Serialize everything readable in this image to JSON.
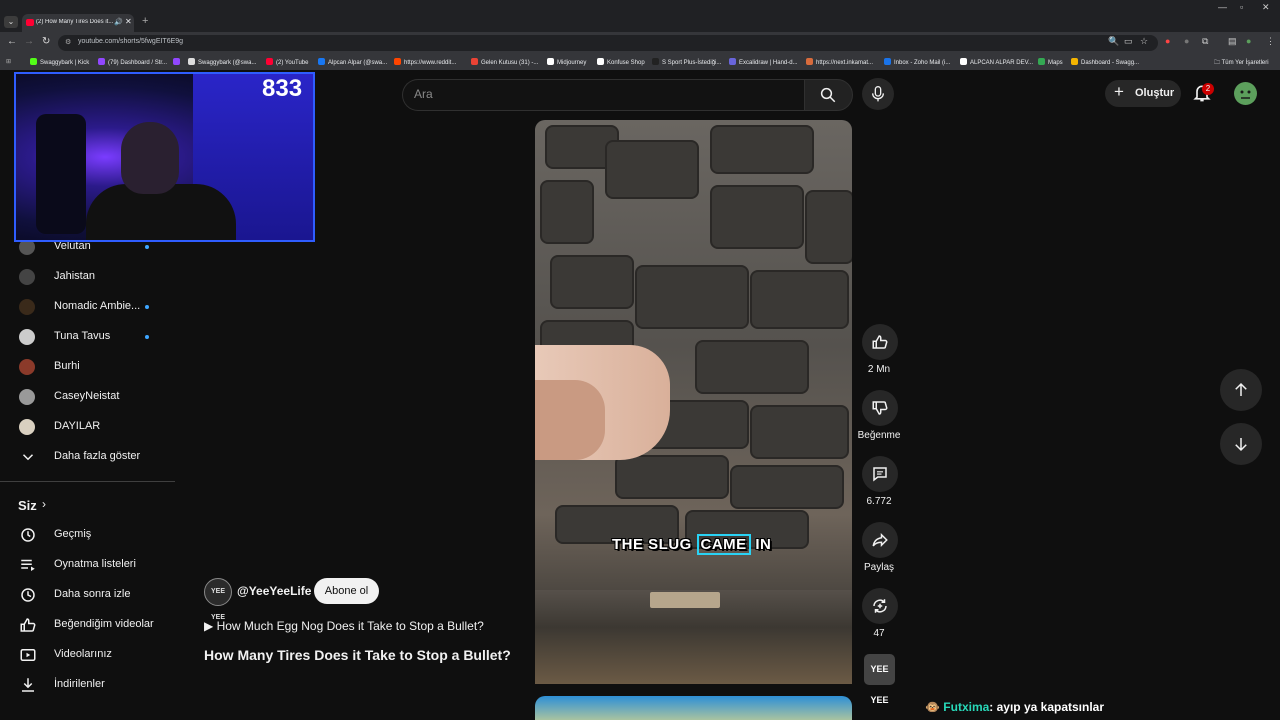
{
  "browser": {
    "tab_title": "(2) How Many Tires Does it...",
    "url": "youtube.com/shorts/5fwgEIT6E9g",
    "bookmarks": [
      {
        "label": "Swaggybark | Kick",
        "color": "#53fc18"
      },
      {
        "label": "(79) Dashboard / Str...",
        "color": "#9147ff"
      },
      {
        "label": "",
        "color": "#9147ff"
      },
      {
        "label": "Swaggybark (@swa...",
        "color": "#dddddd"
      },
      {
        "label": "(2) YouTube",
        "color": "#ff0033"
      },
      {
        "label": "Alpcan Alpar (@swa...",
        "color": "#1877f2"
      },
      {
        "label": "https://www.reddit...",
        "color": "#ff4500"
      },
      {
        "label": "Gelen Kutusu (31) -...",
        "color": "#ea4335"
      },
      {
        "label": "Midjourney",
        "color": "#ffffff"
      },
      {
        "label": "Konfuse Shop",
        "color": "#ffffff"
      },
      {
        "label": "S Sport Plus-İstediği...",
        "color": "#222222"
      },
      {
        "label": "Excalidraw | Hand-d...",
        "color": "#6965db"
      },
      {
        "label": "https://next.inkamat...",
        "color": "#d86b3c"
      },
      {
        "label": "Inbox - Zoho Mail (i...",
        "color": "#1a73e8"
      },
      {
        "label": "ALPCAN ALPAR DEV...",
        "color": "#ffffff"
      },
      {
        "label": "Maps",
        "color": "#34a853"
      },
      {
        "label": "Dashboard - Swagg...",
        "color": "#f4b400"
      }
    ],
    "all_bookmarks": "Tüm Yer İşaretleri"
  },
  "webcam": {
    "viewer_count": "833"
  },
  "sidebar": {
    "subscriptions": [
      {
        "label": "Velutan",
        "dot": true,
        "color": "#555"
      },
      {
        "label": "Jahistan",
        "dot": false,
        "color": "#444"
      },
      {
        "label": "Nomadic Ambie...",
        "dot": true,
        "color": "#3a2a1a"
      },
      {
        "label": "Tuna Tavus",
        "dot": true,
        "color": "#ccc"
      },
      {
        "label": "Burhi",
        "dot": false,
        "color": "#8b3a2a"
      },
      {
        "label": "CaseyNeistat",
        "dot": false,
        "color": "#999"
      },
      {
        "label": "DAYILAR",
        "dot": false,
        "color": "#d9d0c0"
      }
    ],
    "show_more": "Daha fazla göster",
    "you_section": "Siz",
    "you_items": [
      {
        "label": "Geçmiş",
        "icon": "history-icon"
      },
      {
        "label": "Oynatma listeleri",
        "icon": "playlists-icon"
      },
      {
        "label": "Daha sonra izle",
        "icon": "watch-later-icon"
      },
      {
        "label": "Beğendiğim videolar",
        "icon": "liked-videos-icon"
      },
      {
        "label": "Videolarınız",
        "icon": "your-videos-icon"
      },
      {
        "label": "İndirilenler",
        "icon": "downloads-icon"
      }
    ]
  },
  "header": {
    "search_placeholder": "Ara",
    "create_label": "Oluştur",
    "notification_count": "2"
  },
  "video": {
    "caption_before": "THE SLUG ",
    "caption_highlight": "CAME",
    "caption_after": " IN"
  },
  "actions": {
    "likes": "2 Mn",
    "dislike": "Beğenme",
    "comments": "6.772",
    "share": "Paylaş",
    "remix": "47"
  },
  "channel": {
    "avatar_text": "YEE YEE",
    "name": "@YeeYeeLife",
    "subscribe": "Abone ol",
    "related": "How Much Egg Nog Does it Take to Stop a Bullet?",
    "title": "How Many Tires Does it Take to Stop a Bullet?"
  },
  "chat": {
    "user": "Futxima",
    "message": ": ayıp ya kapatsınlar"
  }
}
